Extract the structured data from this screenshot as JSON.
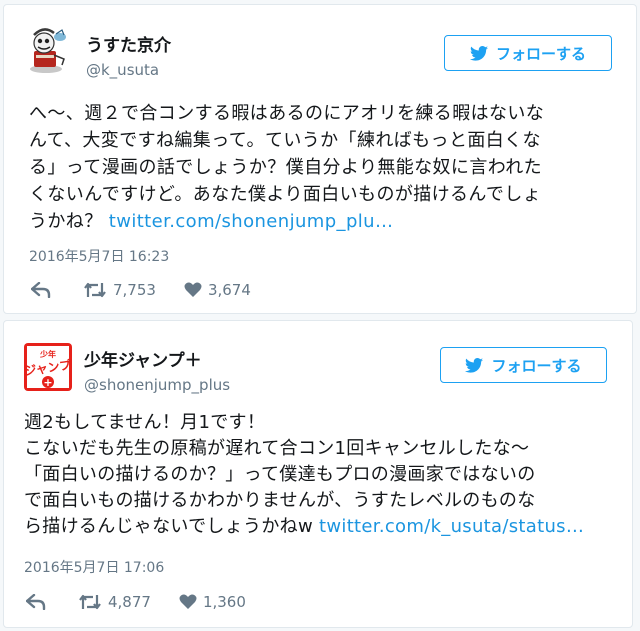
{
  "follow_label": "フォローする",
  "colors": {
    "accent": "#1da1f2",
    "link": "#1b95e0",
    "muted": "#657786",
    "border": "#e1e8ed"
  },
  "tweets": [
    {
      "user": {
        "name": "うすた京介",
        "handle": "@k_usuta"
      },
      "text_lines": [
        "へ～、週２で合コンする暇はあるのにアオリを練る暇はないな",
        "んて、大変ですね編集って。ていうか「練ればもっと面白くな",
        "る」って漫画の話でしょうか？僕自分より無能な奴に言われた",
        "くないんですけど。あなた僕より面白いものが描けるんでしょ"
      ],
      "text_last": "うかね？ ",
      "link": "twitter.com/shonenjump_plu…",
      "timestamp": "2016年5月7日 16:23",
      "retweets": "7,753",
      "likes": "3,674"
    },
    {
      "user": {
        "name": "少年ジャンプ＋",
        "handle": "@shonenjump_plus",
        "avatar_text": [
          "少年",
          "ジャンプ",
          "+"
        ]
      },
      "text_lines": [
        "週2もしてません！月1です！",
        "こないだも先生の原稿が遅れて合コン1回キャンセルしたな～",
        "「面白いの描けるのか？」って僕達もプロの漫画家ではないの",
        "で面白いもの描けるかわかりませんが、うすたレベルのものな"
      ],
      "text_last": "ら描けるんじゃないでしょうかねw ",
      "link": "twitter.com/k_usuta/status…",
      "timestamp": "2016年5月7日 17:06",
      "retweets": "4,877",
      "likes": "1,360"
    }
  ]
}
